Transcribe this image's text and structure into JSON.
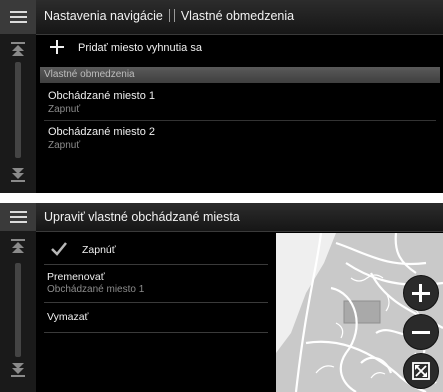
{
  "screen1": {
    "title": "Nastavenia navigácie",
    "title2": "Vlastné obmedzenia",
    "add_label": "Pridať miesto vyhnutia sa",
    "section_header": "Vlastné obmedzenia",
    "items": [
      {
        "name": "Obchádzané miesto 1",
        "status": "Zapnuť"
      },
      {
        "name": "Obchádzané miesto 2",
        "status": "Zapnuť"
      }
    ]
  },
  "screen2": {
    "title": "Upraviť vlastné obchádzané miesta",
    "enable_label": "Zapnúť",
    "rename_label": "Premenovať",
    "rename_value": "Obchádzané miesto 1",
    "delete_label": "Vymazať"
  },
  "icons": [
    "menu-icon",
    "scroll-up-icon",
    "scroll-down-icon",
    "plus-icon",
    "checkmark-icon",
    "zoom-in-icon",
    "zoom-out-icon",
    "fit-view-icon"
  ]
}
